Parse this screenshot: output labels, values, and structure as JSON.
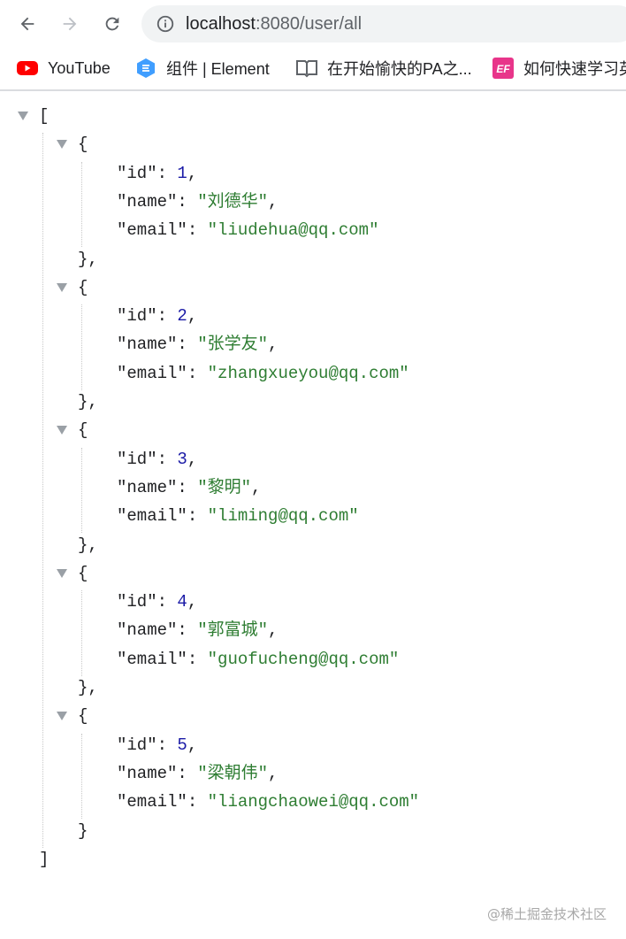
{
  "browser": {
    "url_host": "localhost",
    "url_rest": ":8080/user/all",
    "icons": {
      "back": "arrow-left-icon",
      "forward": "arrow-right-icon",
      "reload": "reload-icon",
      "info": "info-icon"
    }
  },
  "bookmarks": [
    {
      "label": "YouTube",
      "icon": "youtube-icon",
      "color": "#ff0000"
    },
    {
      "label": "组件 | Element",
      "icon": "element-icon",
      "color": "#409eff"
    },
    {
      "label": "在开始愉快的PA之...",
      "icon": "book-icon",
      "color": "#5f6368"
    },
    {
      "label": "如何快速学习英",
      "icon": "ef-icon",
      "color": "#e8358a",
      "badge": "EF"
    }
  ],
  "json": {
    "open_bracket": "[",
    "close_bracket": "]",
    "users": [
      {
        "id": "1",
        "name": "\"刘德华\"",
        "email": "\"liudehua@qq.com\""
      },
      {
        "id": "2",
        "name": "\"张学友\"",
        "email": "\"zhangxueyou@qq.com\""
      },
      {
        "id": "3",
        "name": "\"黎明\"",
        "email": "\"liming@qq.com\""
      },
      {
        "id": "4",
        "name": "\"郭富城\"",
        "email": "\"guofucheng@qq.com\""
      },
      {
        "id": "5",
        "name": "\"梁朝伟\"",
        "email": "\"liangchaowei@qq.com\""
      }
    ],
    "keys": {
      "id": "\"id\"",
      "name": "\"name\"",
      "email": "\"email\""
    }
  },
  "watermark": "@稀土掘金技术社区"
}
